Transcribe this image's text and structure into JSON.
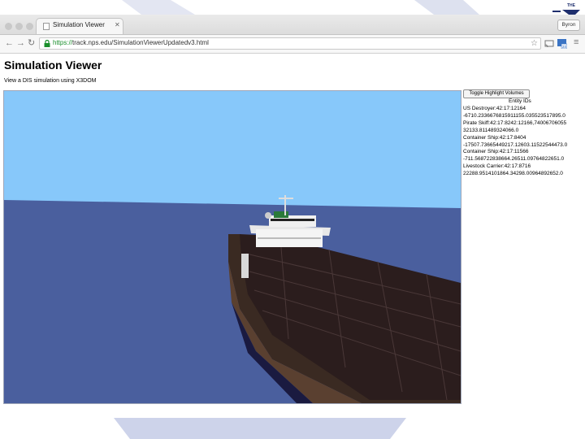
{
  "slide": {
    "logo_text": "THE",
    "accent_color": "#1f2f6e",
    "deco_color": "#d8dcee"
  },
  "browser": {
    "tab_title": "Simulation Viewer",
    "user_chip": "Byron",
    "url_scheme": "https://",
    "url_rest": "track.nps.edu/SimulationViewerUpdatedv3.html",
    "ext_badge": "24"
  },
  "page": {
    "title": "Simulation Viewer",
    "subtitle": "View a DIS simulation using X3DOM",
    "toggle_button": "Toggle Highlight Volumes",
    "entity_header": "Entity IDs",
    "entity_lines": [
      "US Destroyer:42:17:12164",
      "-6710.2336676815911155.035523517895.0",
      "Pirate Skiff:42:17:8242:12166,74006706055",
      "32133.811489324066.0",
      "Container Ship:42:17:8404",
      "-17507.73665449217.12603.11522544473.0",
      "Container Ship:42:17:11566",
      "-711.568722838664.26511.09764822651.0",
      "Livestock Carrier:42:17:8716",
      "22288.9514101864.34298.00964892652.0"
    ]
  },
  "scene": {
    "sky_color": "#87c8fa",
    "sea_color": "#4a5f9e",
    "hull_color": "#3a2a22",
    "deck_color": "#2b1d1d",
    "superstructure_color": "#f4f4f4"
  }
}
